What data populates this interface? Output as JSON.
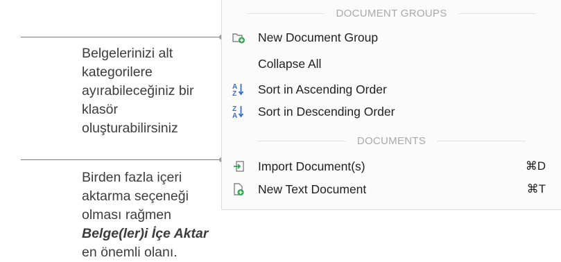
{
  "annotations": {
    "first": "Belgelerinizi alt kategorilere ayırabileceğiniz bir klasör oluşturabilirsiniz",
    "second_before": "Birden fazla içeri aktarma seçeneği olması rağmen",
    "second_em": "Belge(ler)i İçe Aktar",
    "second_after": "en önemli olanı."
  },
  "menu": {
    "document_groups_header": "DOCUMENT GROUPS",
    "documents_header": "DOCUMENTS",
    "items": [
      {
        "label": "New Document Group",
        "icon": "new-group-icon",
        "shortcut": ""
      },
      {
        "label": "Collapse All",
        "icon": "",
        "shortcut": ""
      },
      {
        "label": "Sort in Ascending Order",
        "icon": "sort-ascending-icon",
        "shortcut": ""
      },
      {
        "label": "Sort in Descending Order",
        "icon": "sort-descending-icon",
        "shortcut": ""
      },
      {
        "label": "Import Document(s)",
        "icon": "import-icon",
        "shortcut": "⌘D"
      },
      {
        "label": "New Text Document",
        "icon": "new-text-document-icon",
        "shortcut": "⌘T"
      }
    ]
  },
  "colors": {
    "accent_green": "#2ea44f",
    "sort_blue": "#2b6fd6",
    "text": "#1f1f1f",
    "header_gray": "#a9a9a9"
  }
}
